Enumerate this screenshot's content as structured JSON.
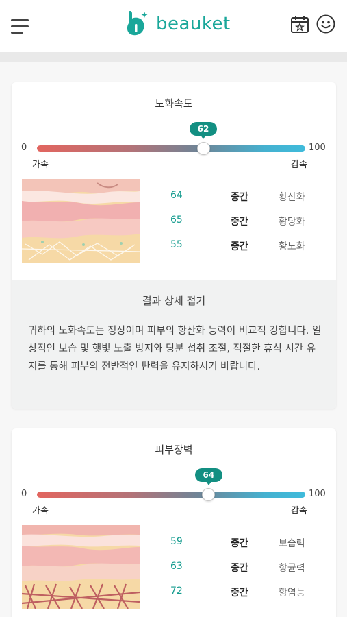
{
  "header": {
    "brand": "beauket",
    "brand_color": "#1aa79a",
    "menu_icon": "hamburger-menu-icon",
    "calendar_icon": "calendar-star-icon",
    "profile_icon": "smile-face-icon"
  },
  "cards": [
    {
      "title": "노화속도",
      "gauge": {
        "min": "0",
        "max": "100",
        "value": 62,
        "value_label": "62",
        "left_pole": "가속",
        "right_pole": "감속"
      },
      "metrics": [
        {
          "value": "64",
          "level": "중간",
          "name": "황산화"
        },
        {
          "value": "65",
          "level": "중간",
          "name": "황당화"
        },
        {
          "value": "55",
          "level": "중간",
          "name": "황노화"
        }
      ],
      "detail_toggle": "결과 상세 접기",
      "detail_text": "귀하의 노화속도는 정상이며 피부의 항산화 능력이 비교적 강합니다. 일상적인 보습 및 햇빛 노출 방지와 당분 섭취 조절, 적절한 휴식 시간 유지를 통해 피부의 전반적인 탄력을 유지하시기 바랍니다."
    },
    {
      "title": "피부장벽",
      "gauge": {
        "min": "0",
        "max": "100",
        "value": 64,
        "value_label": "64",
        "left_pole": "가속",
        "right_pole": "감속"
      },
      "metrics": [
        {
          "value": "59",
          "level": "중간",
          "name": "보습력"
        },
        {
          "value": "63",
          "level": "중간",
          "name": "항균력"
        },
        {
          "value": "72",
          "level": "중간",
          "name": "항염능"
        }
      ]
    }
  ]
}
